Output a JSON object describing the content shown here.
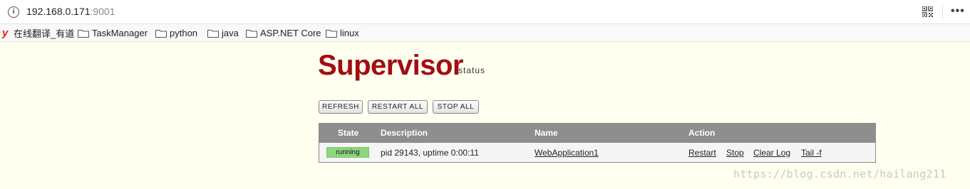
{
  "browser": {
    "url_host": "192.168.0.171",
    "url_port": ":9001",
    "info_icon": "info-icon",
    "qr_icon": "qr-code-icon",
    "menu_icon": "more-dots-icon",
    "bookmarks": [
      {
        "label": "在线翻译_有道",
        "icon": "youdao-icon"
      },
      {
        "label": "TaskManager",
        "icon": "folder-icon"
      },
      {
        "label": "python",
        "icon": "folder-icon"
      },
      {
        "label": "java",
        "icon": "folder-icon"
      },
      {
        "label": "ASP.NET Core",
        "icon": "folder-icon"
      },
      {
        "label": "linux",
        "icon": "folder-icon"
      }
    ]
  },
  "page": {
    "logo": "Supervisor",
    "logo_sub": "status",
    "buttons": {
      "refresh": "REFRESH",
      "restart_all": "RESTART ALL",
      "stop_all": "STOP ALL"
    },
    "table": {
      "headers": {
        "state": "State",
        "description": "Description",
        "name": "Name",
        "action": "Action"
      },
      "rows": [
        {
          "state": "running",
          "description": "pid 29143, uptime 0:00:11",
          "name": "WebApplication1",
          "actions": {
            "restart": "Restart",
            "stop": "Stop",
            "clear_log": "Clear Log",
            "tail": "Tail -f"
          }
        }
      ]
    },
    "watermark": "https://blog.csdn.net/hailang211"
  },
  "colors": {
    "page_bg": "#ffffef",
    "logo": "#a30d12",
    "header_bg": "#8e8e8e",
    "running_badge": "#8fd67f"
  }
}
